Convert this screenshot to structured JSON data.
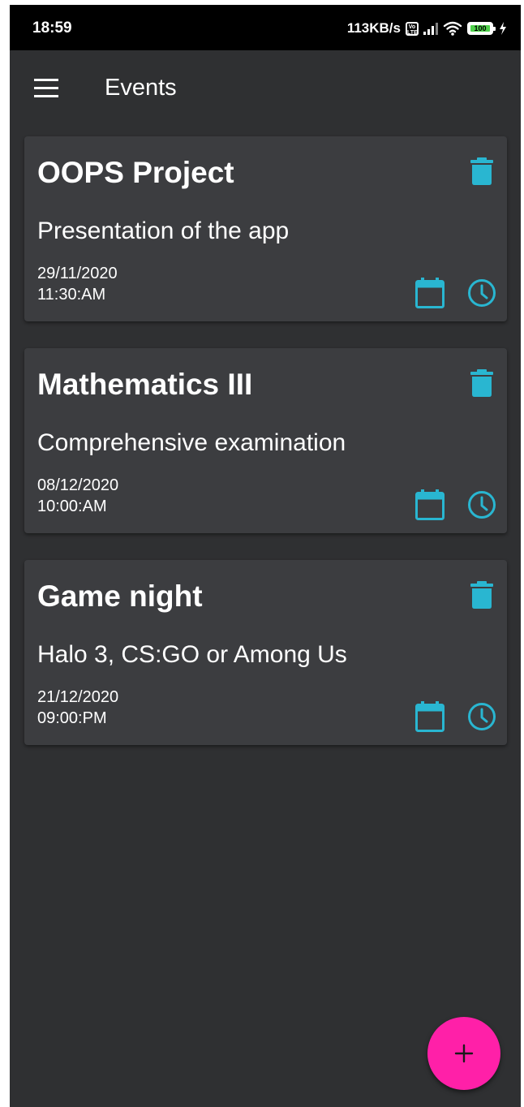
{
  "status_bar": {
    "time": "18:59",
    "network_speed": "113KB/s",
    "volte_label": "Vo LTE",
    "battery_level": "100",
    "icons": [
      "volte-icon",
      "signal-icon",
      "wifi-icon",
      "battery-icon",
      "charging-icon"
    ]
  },
  "app_bar": {
    "title": "Events",
    "menu_icon": "hamburger-menu-icon"
  },
  "events": [
    {
      "title": "OOPS Project",
      "description": "Presentation of the app",
      "date": "29/11/2020",
      "time": "11:30:AM"
    },
    {
      "title": "Mathematics III",
      "description": "Comprehensive examination",
      "date": "08/12/2020",
      "time": "10:00:AM"
    },
    {
      "title": "Game night",
      "description": "Halo 3, CS:GO or Among Us",
      "date": "21/12/2020",
      "time": "09:00:PM"
    }
  ],
  "card_icons": {
    "delete": "trash-icon",
    "calendar": "calendar-icon",
    "clock": "clock-icon"
  },
  "fab": {
    "icon": "plus-icon"
  },
  "colors": {
    "background": "#2f3032",
    "card": "#3c3d40",
    "accent": "#29b6d1",
    "fab": "#ff20a8",
    "text": "#ffffff"
  }
}
